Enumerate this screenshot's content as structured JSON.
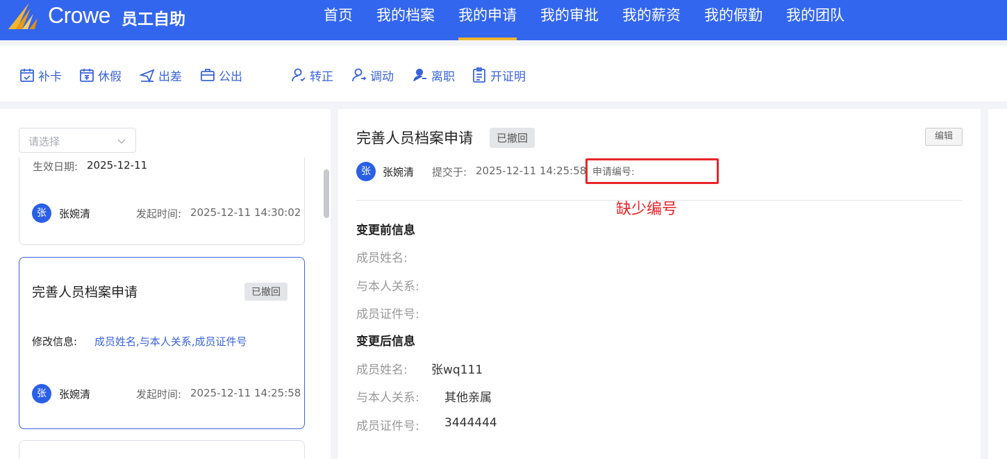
{
  "header": {
    "brand": "Crowe",
    "app_name": "员工自助",
    "nav": [
      "首页",
      "我的档案",
      "我的申请",
      "我的审批",
      "我的薪资",
      "我的假勤",
      "我的团队"
    ],
    "active_nav": "我的申请",
    "accent_color": "#3366ee",
    "active_underline_color": "#f2b630"
  },
  "toolbar": {
    "items": [
      {
        "label": "补卡",
        "icon": "calendar-check-icon"
      },
      {
        "label": "休假",
        "icon": "calendar-leave-icon"
      },
      {
        "label": "出差",
        "icon": "plane-trip-icon"
      },
      {
        "label": "公出",
        "icon": "briefcase-icon"
      },
      {
        "label": "转正",
        "icon": "user-regular-icon"
      },
      {
        "label": "调动",
        "icon": "user-transfer-icon"
      },
      {
        "label": "离职",
        "icon": "user-leave-icon"
      },
      {
        "label": "开证明",
        "icon": "clipboard-icon"
      }
    ]
  },
  "list": {
    "filter_placeholder": "请选择",
    "cards": [
      {
        "effective_label": "生效日期:",
        "effective_date": "2025-12-11",
        "avatar": "张",
        "user": "张婉清",
        "time_label": "发起时间:",
        "time": "2025-12-11 14:30:02"
      },
      {
        "title": "完善人员档案申请",
        "status": "已撤回",
        "modify_label": "修改信息:",
        "modify_value": "成员姓名,与本人关系,成员证件号",
        "avatar": "张",
        "user": "张婉清",
        "time_label": "发起时间:",
        "time": "2025-12-11 14:25:58"
      }
    ]
  },
  "detail": {
    "title": "完善人员档案申请",
    "status": "已撤回",
    "edit_label": "编辑",
    "avatar": "张",
    "user": "张婉清",
    "submit_label": "提交于:",
    "submit_time": "2025-12-11 14:25:58",
    "app_no_label": "申请编号:",
    "annotation": "缺少编号",
    "annotation_color": "#e8252a",
    "before_title": "变更前信息",
    "after_title": "变更后信息",
    "fields": {
      "name_label": "成员姓名:",
      "relation_label": "与本人关系:",
      "id_label": "成员证件号:"
    },
    "after_values": {
      "name": "张wq111",
      "relation": "其他亲属",
      "id": "3444444"
    }
  }
}
